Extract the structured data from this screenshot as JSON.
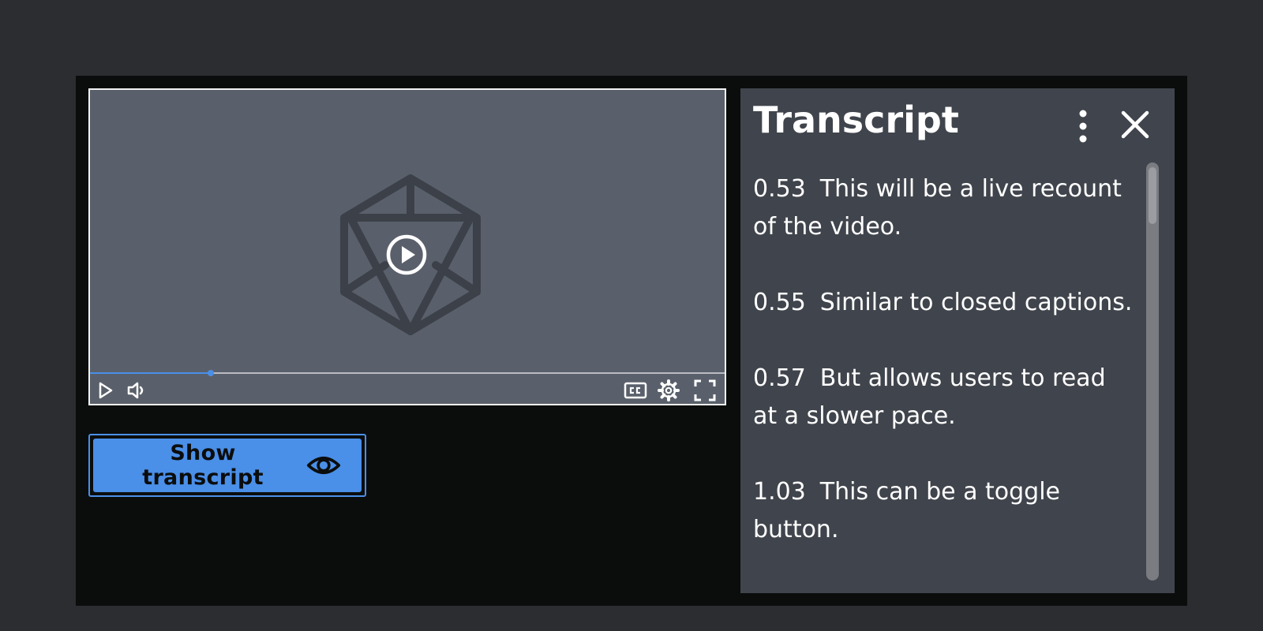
{
  "video": {
    "progress_fraction": 0.19,
    "controls": [
      {
        "name": "play-icon"
      },
      {
        "name": "volume-icon"
      },
      {
        "name": "closed-captions-icon"
      },
      {
        "name": "settings-gear-icon"
      },
      {
        "name": "fullscreen-icon"
      }
    ]
  },
  "toggle_button": {
    "label": "Show transcript",
    "icon": "eye-icon"
  },
  "transcript": {
    "title": "Transcript",
    "entries": [
      {
        "time": "0.53",
        "text": "This will be a live recount of the video."
      },
      {
        "time": "0.55",
        "text": "Similar to closed captions."
      },
      {
        "time": "0.57",
        "text": "But allows users to read at a slower pace."
      },
      {
        "time": "1.03",
        "text": "This can be a toggle button."
      }
    ]
  },
  "colors": {
    "accent": "#4a8fe8",
    "background": "#2b2d31",
    "frame": "#0b0d0d",
    "video_bg": "#5a606b",
    "panel_bg": "#40444c"
  }
}
